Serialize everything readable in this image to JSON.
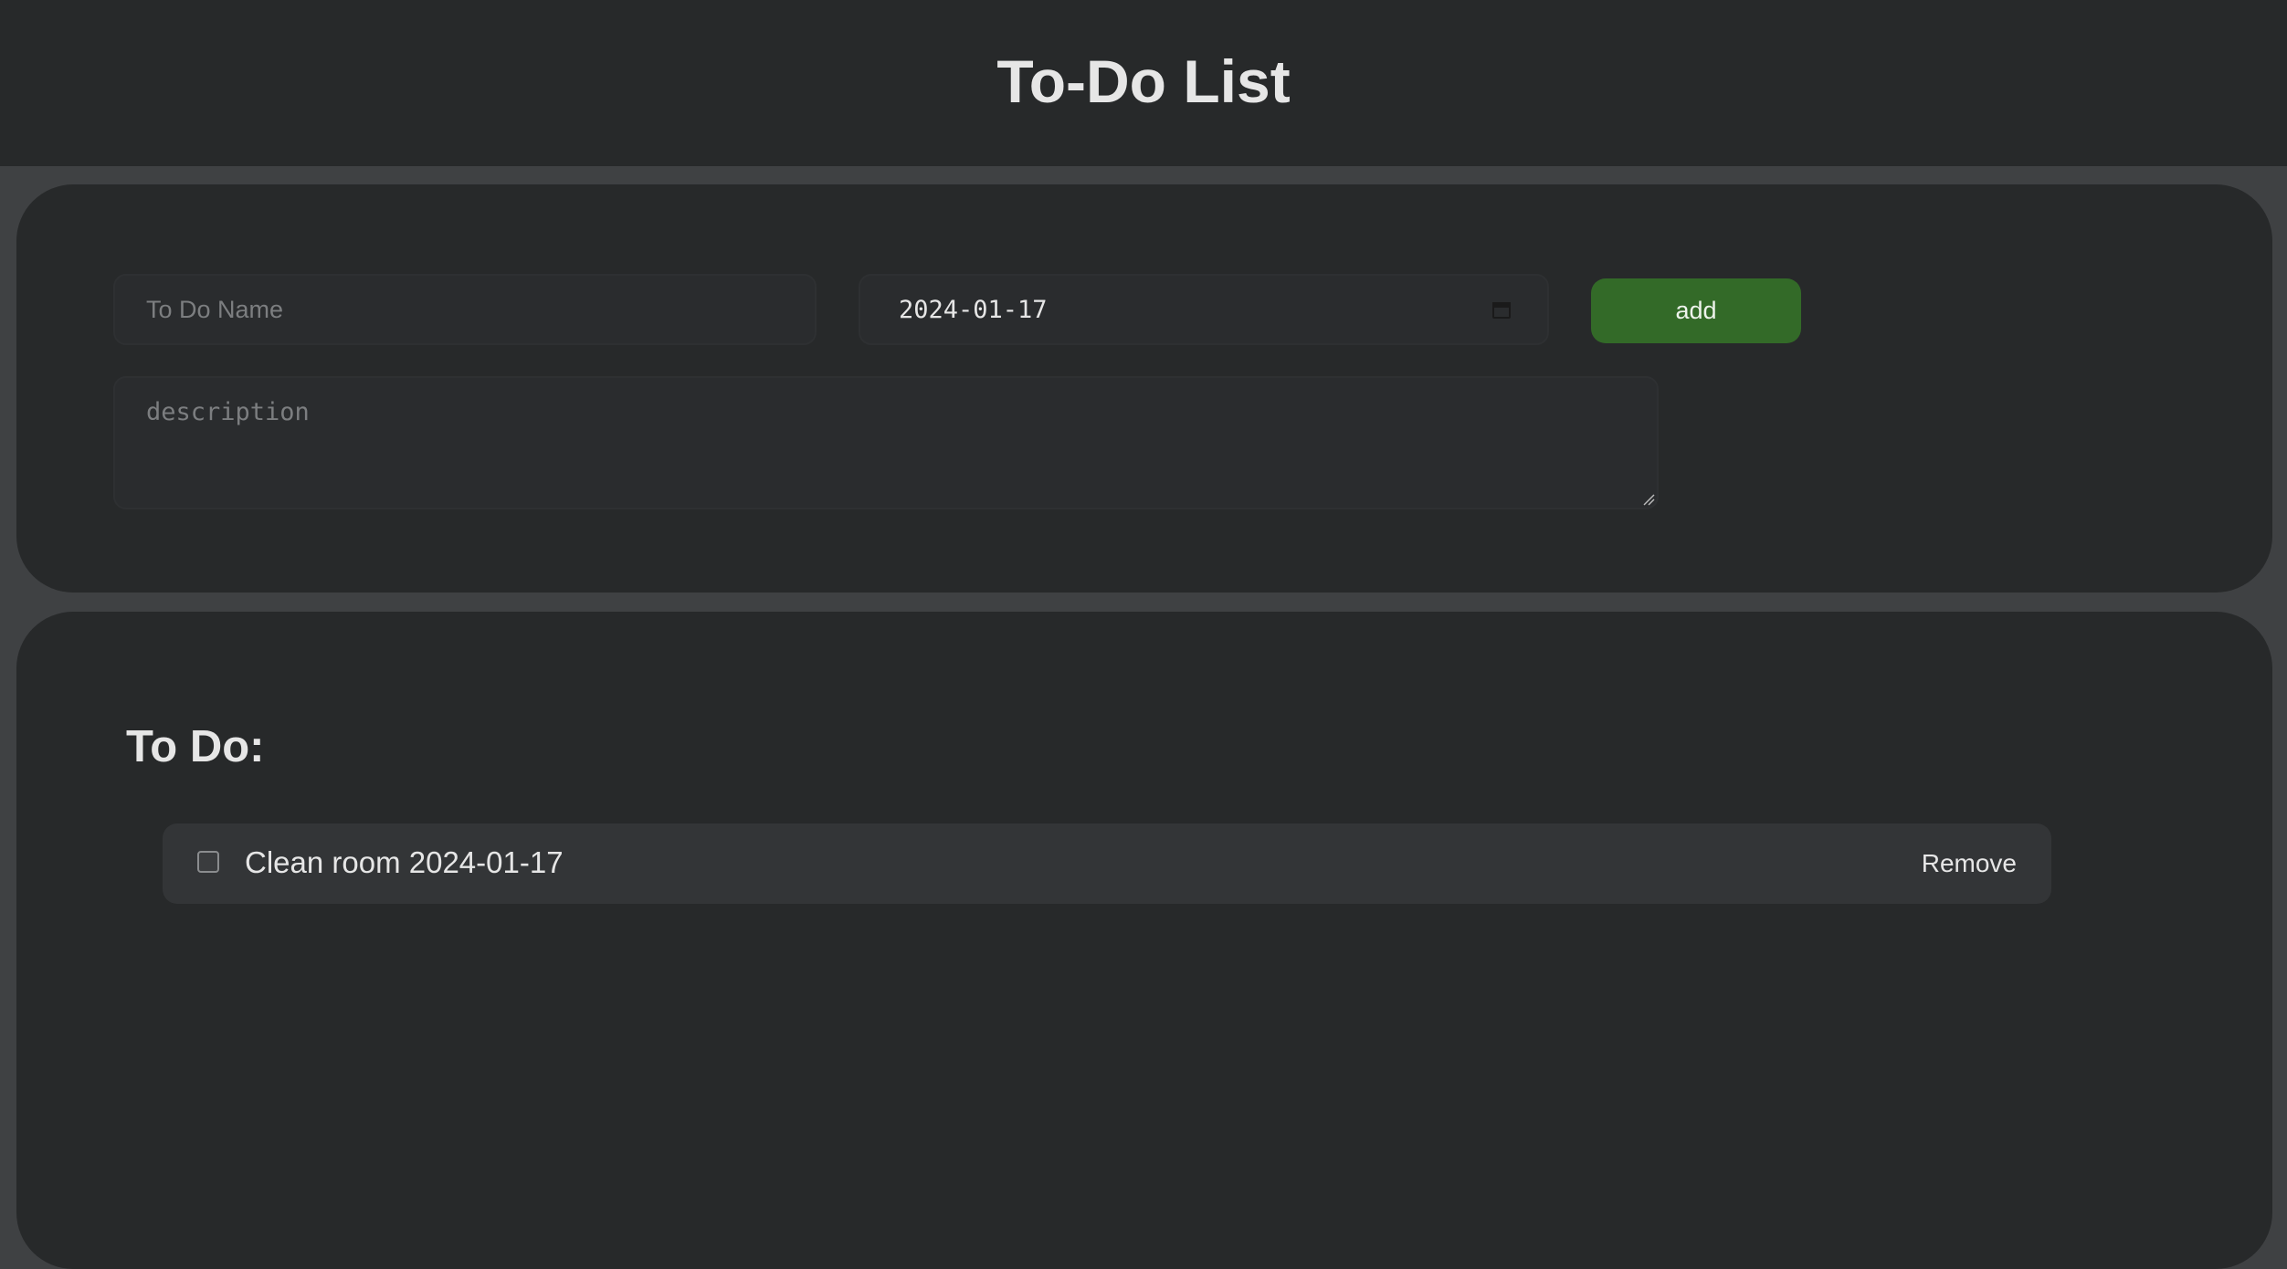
{
  "header": {
    "title": "To-Do List"
  },
  "form": {
    "name_placeholder": "To Do Name",
    "name_value": "",
    "date_value": "2024-01-17",
    "add_label": "add",
    "description_placeholder": "description",
    "description_value": ""
  },
  "list": {
    "heading": "To Do:",
    "items": [
      {
        "text": "Clean room 2024-01-17",
        "checked": false,
        "remove_label": "Remove"
      }
    ]
  },
  "colors": {
    "page_background": "#3f4143",
    "card_background": "#27292a",
    "accent_green": "#336a28",
    "item_background": "#333537",
    "text": "#e6e6e6"
  },
  "icons": {
    "date_picker": "calendar-icon",
    "textarea_corner": "resize-handle-icon",
    "item_check": "checkbox"
  }
}
